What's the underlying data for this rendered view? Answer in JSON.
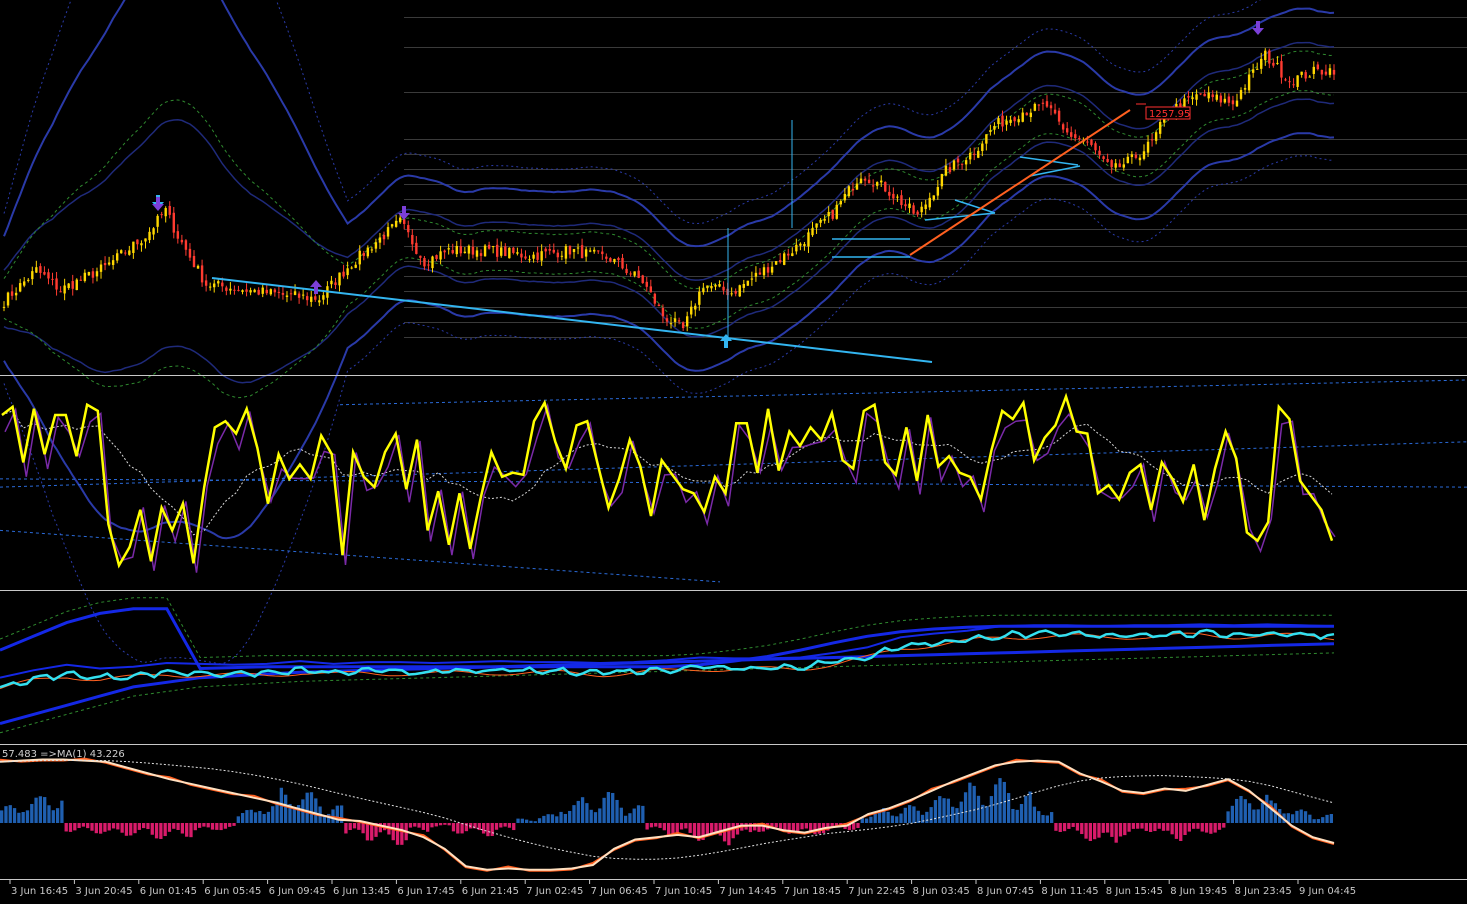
{
  "colors": {
    "background": "#000000",
    "separator": "#c8c8c8",
    "candle_up": "#ffd700",
    "candle_down": "#ff3b30",
    "trendline": "#33b5f0",
    "channel_inner": "#1f2a7a",
    "channel_outer": "#2a3aa8",
    "envelope_green": "#2f8a2f",
    "main_oscillator": "#ffff00",
    "signal_purple": "#7a2aa8",
    "cyan_line": "#33e0f0",
    "orange_line": "#ff6020",
    "band_blue": "#1428e6",
    "hist_up": "#1f5fb0",
    "hist_down": "#d81b6a",
    "cream_line": "#ffe0c0",
    "arrow_down": "#7b3fd8",
    "arrow_up": "#33b5f0"
  },
  "icons": {
    "signal_down": "down-arrow-icon",
    "signal_up": "up-arrow-icon"
  },
  "price_tag": "1257.95",
  "bottom_indicator_label": "57.483  =>MA(1) 43.226",
  "chart_data": [
    {
      "type": "candlestick",
      "panel": "price",
      "x_labels": [
        "3 Jun 16:45",
        "3 Jun 20:45",
        "6 Jun 01:45",
        "6 Jun 05:45",
        "6 Jun 09:45",
        "6 Jun 13:45",
        "6 Jun 17:45",
        "6 Jun 21:45",
        "7 Jun 02:45",
        "7 Jun 06:45",
        "7 Jun 10:45",
        "7 Jun 14:45",
        "7 Jun 18:45",
        "7 Jun 22:45",
        "8 Jun 03:45",
        "8 Jun 07:45",
        "8 Jun 11:45",
        "8 Jun 15:45",
        "8 Jun 19:45",
        "8 Jun 23:45",
        "9 Jun 04:45"
      ],
      "bar_count": 330,
      "close_path": [
        [
          0,
          1180
        ],
        [
          8,
          1191
        ],
        [
          14,
          1184
        ],
        [
          25,
          1192
        ],
        [
          35,
          1203
        ],
        [
          40,
          1212
        ],
        [
          43,
          1203
        ],
        [
          50,
          1186
        ],
        [
          60,
          1184
        ],
        [
          70,
          1182
        ],
        [
          78,
          1181
        ],
        [
          85,
          1192
        ],
        [
          92,
          1201
        ],
        [
          98,
          1208
        ],
        [
          104,
          1194
        ],
        [
          110,
          1198
        ],
        [
          120,
          1198
        ],
        [
          130,
          1196
        ],
        [
          140,
          1198
        ],
        [
          150,
          1195
        ],
        [
          158,
          1187
        ],
        [
          163,
          1175
        ],
        [
          168,
          1170
        ],
        [
          173,
          1186
        ],
        [
          180,
          1183
        ],
        [
          186,
          1189
        ],
        [
          195,
          1198
        ],
        [
          205,
          1211
        ],
        [
          212,
          1225
        ],
        [
          218,
          1220
        ],
        [
          226,
          1210
        ],
        [
          233,
          1226
        ],
        [
          240,
          1233
        ],
        [
          245,
          1242
        ],
        [
          252,
          1247
        ],
        [
          258,
          1249
        ],
        [
          262,
          1240
        ],
        [
          268,
          1236
        ],
        [
          274,
          1226
        ],
        [
          279,
          1230
        ],
        [
          284,
          1236
        ],
        [
          288,
          1247
        ],
        [
          296,
          1253
        ],
        [
          304,
          1250
        ],
        [
          312,
          1267
        ],
        [
          318,
          1258
        ],
        [
          324,
          1261
        ],
        [
          329,
          1262
        ]
      ],
      "y_range": [
        1155,
        1285
      ],
      "price_tag": 1257.95
    },
    {
      "type": "line",
      "panel": "oscillator",
      "series": [
        {
          "name": "",
          "values": [
            83,
            87,
            60,
            86,
            64,
            83,
            83,
            63,
            88,
            85,
            30,
            10,
            19,
            37,
            12,
            38,
            27,
            40,
            11,
            48,
            77,
            80,
            74,
            86,
            67,
            40,
            64,
            52,
            59,
            52,
            73,
            64,
            15,
            65,
            53,
            48,
            65,
            74,
            47,
            71,
            27,
            46,
            20,
            45,
            18,
            43,
            65,
            53,
            55,
            54,
            80,
            89,
            70,
            57,
            78,
            80,
            59,
            38,
            52,
            71,
            58,
            34,
            61,
            54,
            47,
            45,
            36,
            53,
            45,
            79,
            79,
            55,
            86,
            56,
            75,
            68,
            77,
            71,
            84,
            61,
            57,
            85,
            88,
            60,
            54,
            77,
            51,
            83,
            58,
            63,
            55,
            53,
            42,
            66,
            85,
            81,
            89,
            61,
            72,
            78,
            92,
            75,
            74,
            45,
            49,
            42,
            55,
            59,
            37,
            60,
            52,
            41,
            59,
            32,
            57,
            75,
            62,
            26,
            22,
            31,
            87,
            81,
            51,
            44,
            37,
            22
          ]
        }
      ],
      "y_range": [
        0,
        100
      ]
    },
    {
      "type": "line",
      "panel": "strength",
      "series": [
        {
          "name": "",
          "values": [
            0,
            8,
            14,
            10,
            12,
            16,
            15,
            14,
            15,
            18,
            15,
            17,
            17,
            16,
            17,
            18,
            17,
            17,
            16,
            17,
            19,
            22,
            21,
            21,
            22,
            27,
            33,
            44,
            48,
            51,
            56,
            57,
            57,
            56,
            57,
            57,
            58,
            57,
            58,
            57,
            56
          ]
        },
        {
          "name": "",
          "values": [
            -40,
            -30,
            -20,
            -10,
            0,
            5,
            10,
            12,
            14,
            16,
            17,
            18,
            19,
            20,
            21,
            22,
            23,
            24,
            25,
            26,
            27,
            28,
            29,
            30,
            31,
            32,
            33,
            34,
            35,
            36,
            37,
            38,
            39,
            40,
            41,
            42,
            43,
            44,
            45,
            46,
            47
          ]
        },
        {
          "name": "",
          "values": [
            40,
            55,
            70,
            80,
            85,
            85,
            20,
            21,
            22,
            22,
            22,
            22,
            22,
            22,
            22,
            22,
            22,
            22,
            22,
            22,
            22,
            24,
            28,
            33,
            40,
            48,
            55,
            60,
            63,
            65,
            66,
            66,
            66,
            66,
            66,
            66,
            66,
            66,
            66,
            66,
            66
          ]
        }
      ],
      "y_range": [
        -60,
        100
      ]
    },
    {
      "type": "bar",
      "panel": "histogram",
      "series": [
        {
          "name": "",
          "values": [
            20,
            30,
            35,
            -10,
            -12,
            -15,
            -14,
            -18,
            -16,
            -10,
            -8,
            15,
            25,
            40,
            35,
            20,
            -15,
            -20,
            -25,
            -10,
            -5,
            -12,
            -15,
            -10,
            5,
            10,
            25,
            30,
            35,
            20,
            -10,
            -15,
            -20,
            -25,
            -18,
            -10,
            -12,
            -15,
            -12,
            -8,
            12,
            18,
            20,
            30,
            40,
            45,
            50,
            35,
            20,
            -10,
            -20,
            -25,
            -15,
            -10,
            -20,
            -15,
            -12,
            30,
            35,
            25,
            15,
            10
          ]
        },
        {
          "name": "",
          "values": [
            95,
            96,
            97,
            97,
            96,
            95,
            90,
            85,
            80,
            76,
            72,
            68,
            64,
            60,
            55,
            50,
            45,
            44,
            40,
            36,
            30,
            20,
            5,
            2,
            3,
            2,
            2,
            3,
            6,
            20,
            28,
            30,
            32,
            30,
            35,
            40,
            40,
            36,
            34,
            38,
            40,
            50,
            55,
            62,
            70,
            78,
            85,
            92,
            95,
            96,
            95,
            85,
            78,
            70,
            68,
            72,
            70,
            75,
            80,
            70,
            55,
            40,
            30,
            25
          ]
        }
      ],
      "y_range": [
        -100,
        100
      ]
    }
  ]
}
